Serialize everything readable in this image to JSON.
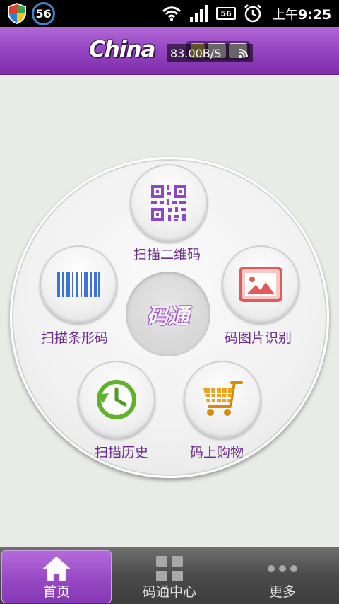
{
  "status_bar": {
    "badge": "56",
    "network_box": "56",
    "time_prefix": "上午",
    "time": "9:25"
  },
  "header": {
    "logo_text": "China",
    "speed": "83.00B/S"
  },
  "menu": {
    "qr": "扫描二维码",
    "barcode": "扫描条形码",
    "image": "码图片识别",
    "history": "扫描历史",
    "shop": "码上购物",
    "center": "码通"
  },
  "tabs": [
    {
      "label": "首页",
      "active": true
    },
    {
      "label": "码通中心",
      "active": false
    },
    {
      "label": "更多",
      "active": false
    }
  ],
  "colors": {
    "accent": "#9847c4",
    "label": "#6b2d8d",
    "barcode_blue": "#3f72d8",
    "image_red": "#e35a5a",
    "history_green": "#5fb12e",
    "cart_orange": "#f0a21a"
  }
}
